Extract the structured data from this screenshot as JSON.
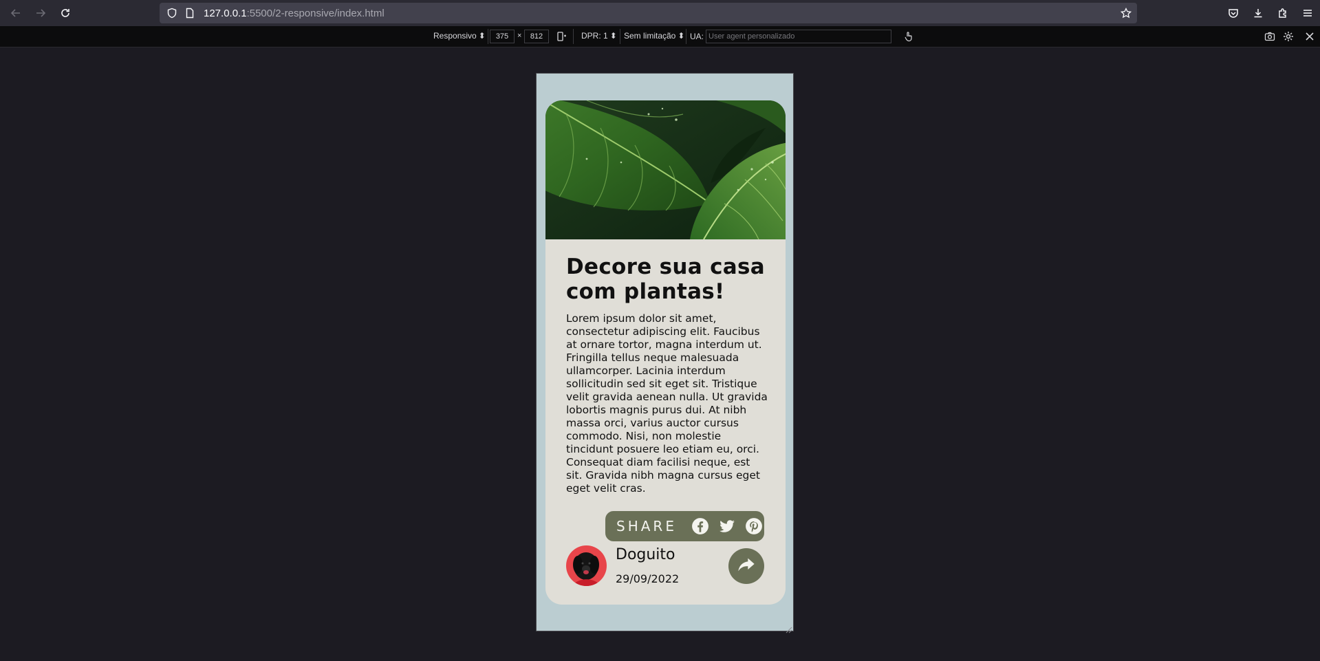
{
  "browser": {
    "url_host": "127.0.0.1",
    "url_path": ":5500/2-responsive/index.html"
  },
  "rdm": {
    "device": "Responsivo",
    "width": "375",
    "times": "×",
    "height": "812",
    "dpr": "DPR: 1",
    "throttle": "Sem limitação",
    "ua_label": "UA:",
    "ua_placeholder": "User agent personalizado"
  },
  "card": {
    "title": "Decore sua casa com plantas!",
    "body": "Lorem ipsum dolor sit amet, consectetur adipiscing elit. Faucibus at ornare tortor, magna interdum ut. Fringilla tellus neque malesuada ullamcorper. Lacinia interdum sollicitudin sed sit eget sit. Tristique velit gravida aenean nulla. Ut gravida lobortis magnis purus dui. At nibh massa orci, varius auctor cursus commodo. Nisi, non molestie tincidunt posuere leo etiam eu, orci. Consequat diam facilisi neque, est sit. Gravida nibh magna cursus eget eget velit cras.",
    "share_label": "SHARE",
    "share_icons": [
      "facebook-icon",
      "twitter-icon",
      "pinterest-icon"
    ],
    "author": "Doguito",
    "date": "29/09/2022"
  },
  "colors": {
    "page_bg": "#bbcdd1",
    "card_bg": "#e0ded7",
    "accent": "#6a7057"
  }
}
